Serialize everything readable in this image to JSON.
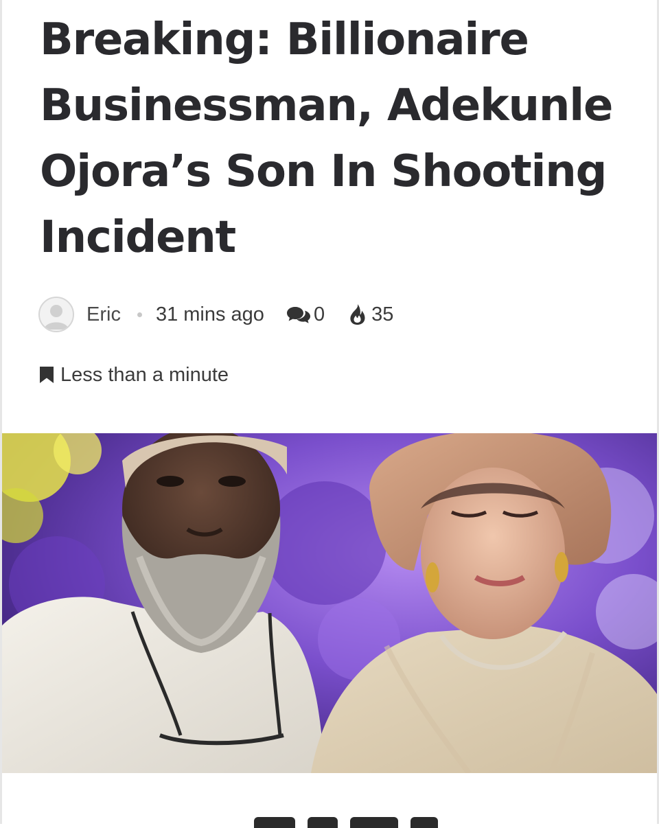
{
  "article": {
    "headline": "Breaking: Billionaire Businessman, Adekunle Ojora’s Son In Shooting Incident",
    "author": "Eric",
    "time_ago": "31 mins ago",
    "comments_count": "0",
    "views_count": "35",
    "reading_time": "Less than a minute"
  },
  "icons": {
    "avatar": "user-avatar-placeholder",
    "comments": "comments-icon",
    "views": "fire-icon",
    "reading_time": "bookmark-icon"
  },
  "colors": {
    "headline": "#2a2a2e",
    "meta_text": "#3b3b3b",
    "separator_dot": "#c8c8c8",
    "image_background": "#7b55c9"
  }
}
